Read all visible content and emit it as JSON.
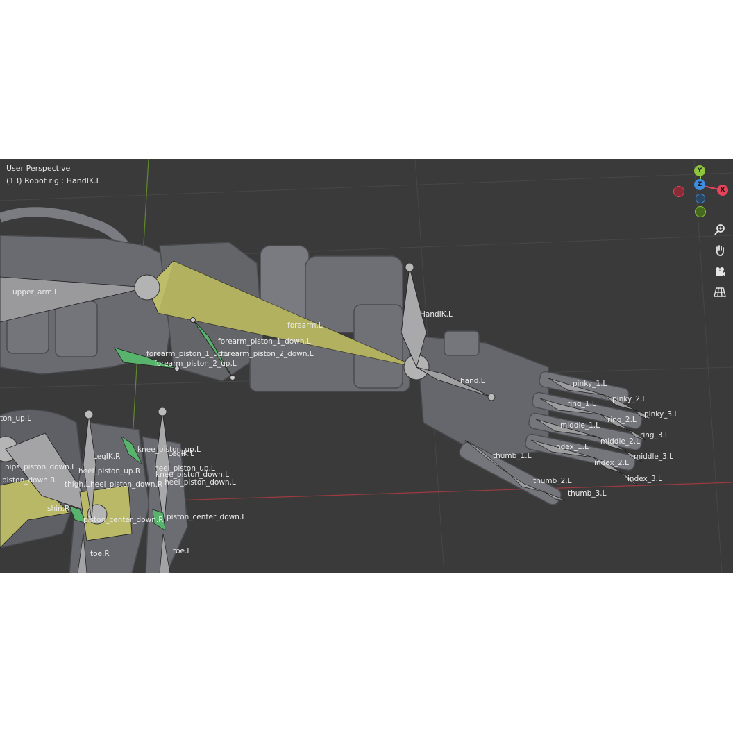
{
  "viewport": {
    "view_name": "User Perspective",
    "object_info": "(13) Robot rig : HandIK.L"
  },
  "gizmo": {
    "y_label": "Y",
    "z_label": "Z",
    "x_label": "X",
    "colors": {
      "x": "#e2445c",
      "y": "#8ec53a",
      "z": "#3d8ee0"
    }
  },
  "nav_buttons": [
    "zoom-icon",
    "hand-pan-icon",
    "camera-icon",
    "grid-ortho-icon"
  ],
  "bones": {
    "upper_arm": "upper_arm.L",
    "forearm": "forearm.L",
    "hand_ik": "HandIK.L",
    "forearm_piston_1_down": "forearm_piston_1_down.L",
    "forearm_piston_1_up": "forearm_piston_1_up.L",
    "forearm_piston_2_down": "forearm_piston_2_down.L",
    "forearm_piston_2_up": "forearm_piston_2_up.L",
    "hand": "hand.L",
    "pinky_1": "pinky_1.L",
    "pinky_2": "pinky_2.L",
    "pinky_3": "pinky_3.L",
    "ring_1": "ring_1.L",
    "ring_2": "ring_2.L",
    "ring_3": "ring_3.L",
    "middle_1": "middle_1.L",
    "middle_2": "middle_2.L",
    "middle_3": "middle_3.L",
    "index_1": "index_1.L",
    "index_2": "index_2.L",
    "index_3": "index_3.L",
    "thumb_1": "thumb_1.L",
    "thumb_2": "thumb_2.L",
    "thumb_3": "thumb_3.L",
    "ton_up": "ton_up.L",
    "hips_piston_down": "hips_piston_down.L",
    "piston_down_r": "piston_down.R",
    "leg_ik_r": "LegIK.R",
    "leg_ik_l": "LegIK.L",
    "knee_piston_up": "knee_piston_up.L",
    "heel_piston_up_r": "heel_piston_up.R",
    "heel_piston_up_l": "heel_piston_up.L",
    "knee_piston_down": "knee_piston_down.L",
    "thigh_l": "thigh.L",
    "heel_piston_down_r": "heel_piston_down.R",
    "heel_piston_down_l": "heel_piston_down.L",
    "shin_r": "shin.R",
    "piston_center_down_r": "piston_center_down.R",
    "piston_center_down_l": "piston_center_down.L",
    "toe_r": "toe.R",
    "toe_l": "toe.L"
  }
}
